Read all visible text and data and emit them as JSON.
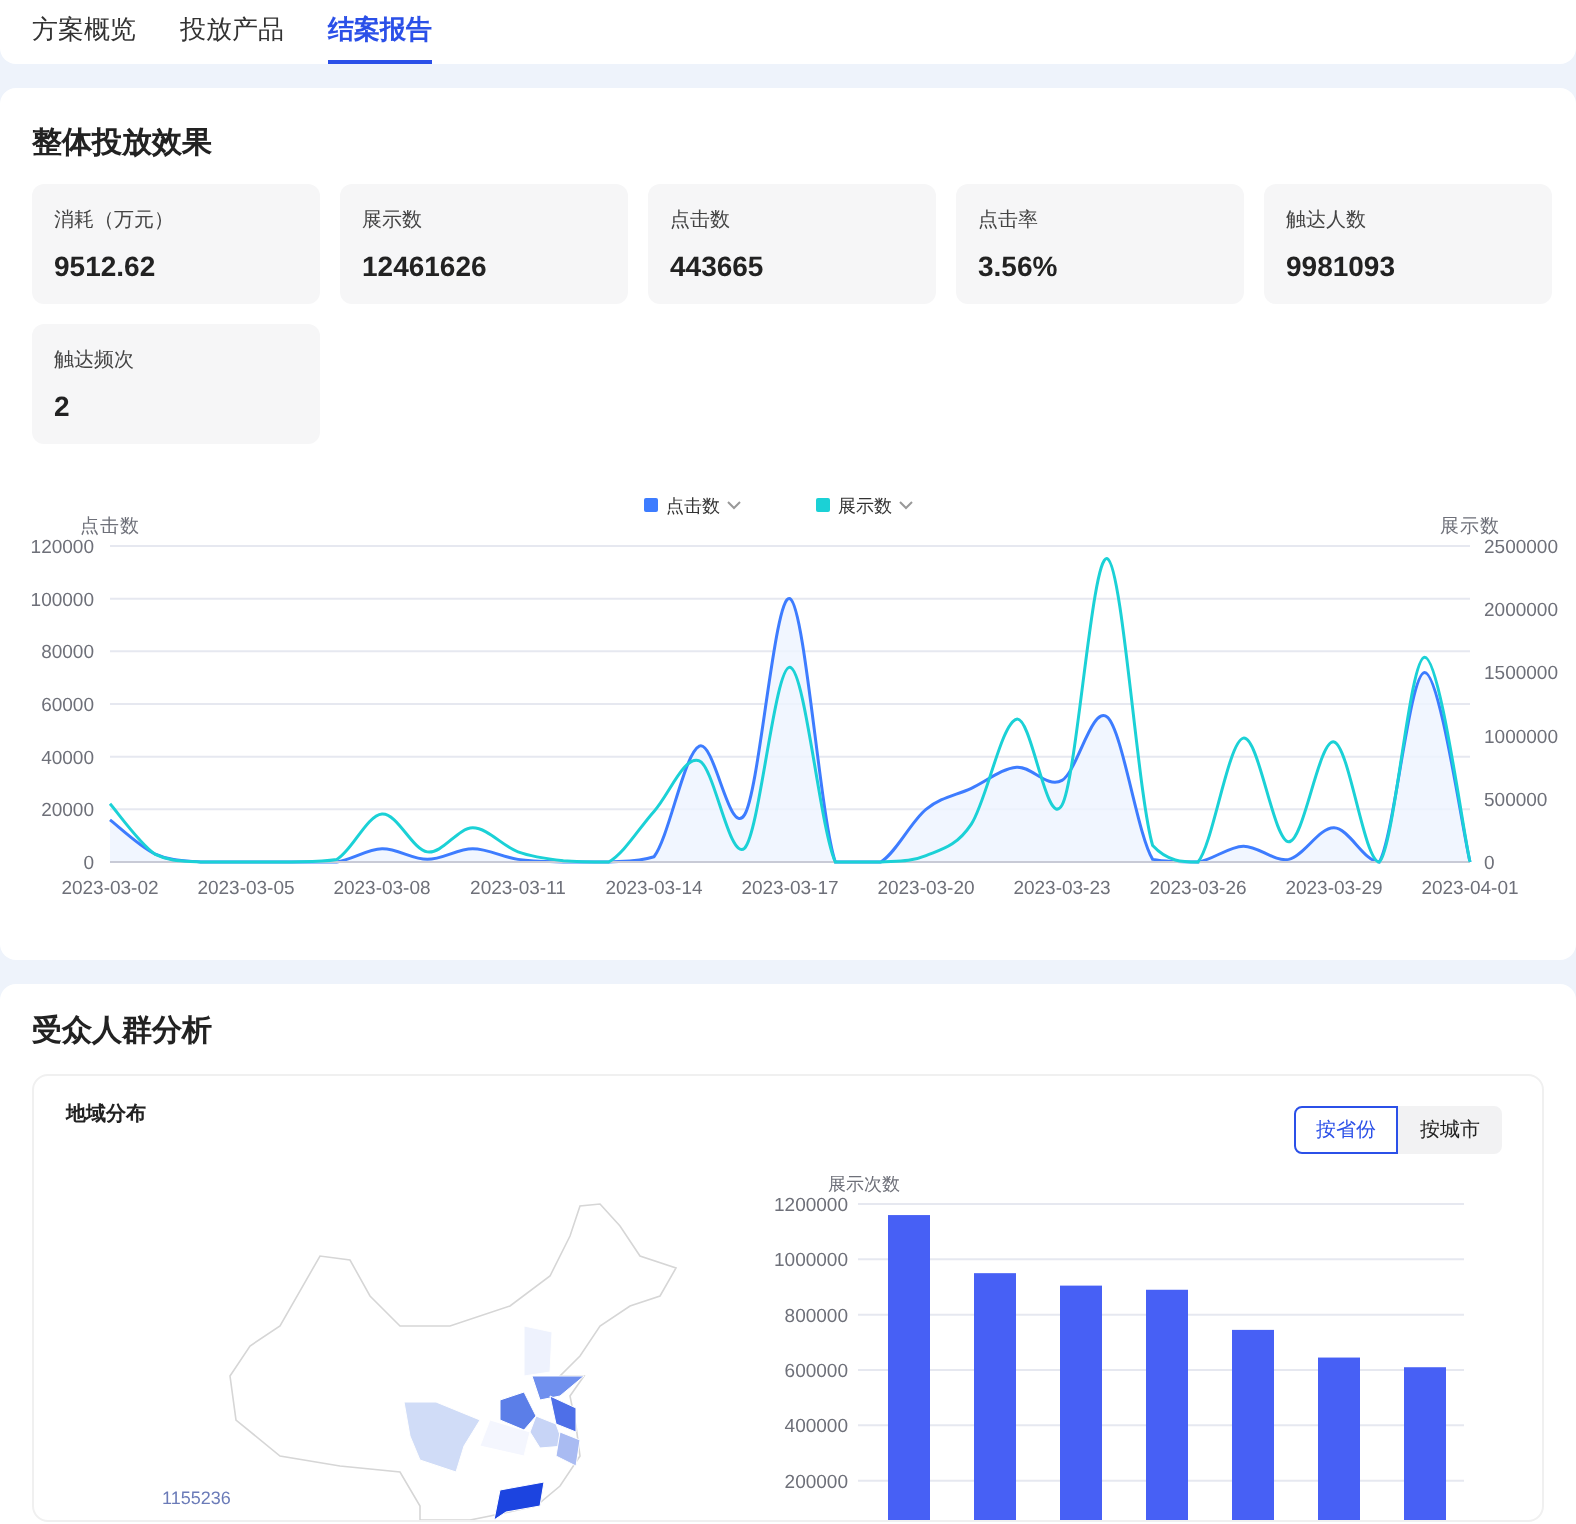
{
  "tabs": [
    {
      "label": "方案概览",
      "selected": false
    },
    {
      "label": "投放产品",
      "selected": false
    },
    {
      "label": "结案报告",
      "selected": true
    }
  ],
  "overview": {
    "title": "整体投放效果",
    "metrics": [
      {
        "label": "消耗（万元）",
        "value": "9512.62"
      },
      {
        "label": "展示数",
        "value": "12461626"
      },
      {
        "label": "点击数",
        "value": "443665"
      },
      {
        "label": "点击率",
        "value": "3.56%"
      },
      {
        "label": "触达人数",
        "value": "9981093"
      },
      {
        "label": "触达频次",
        "value": "2"
      }
    ],
    "click_chart": {
      "chart_data": {
        "type": "line",
        "ylabel": "点击数",
        "grid": true,
        "categories": [
          "2023-03-02",
          null,
          null,
          "2023-03-05",
          null,
          null,
          "2023-03-08",
          null,
          null,
          "2023-03-11",
          null,
          null,
          "2023-03-14",
          null,
          null,
          "2023-03-17",
          null,
          null,
          "2023-03-20",
          null,
          null,
          "2023-03-23",
          null,
          null,
          "2023-03-26",
          null,
          null,
          "2023-03-29",
          null,
          null,
          "2023-04-01"
        ],
        "ylim": [
          0,
          120000
        ],
        "yticks": [
          0,
          20000,
          40000,
          60000,
          80000,
          100000,
          120000
        ],
        "series": [
          {
            "name": "点击数",
            "color": "#3d7cff",
            "values": [
              16000,
              3000,
              0,
              0,
              0,
              0,
              5000,
              1000,
              5000,
              1000,
              0,
              0,
              2000,
              44000,
              18000,
              100000,
              0,
              0,
              20000,
              28000,
              36000,
              31000,
              55000,
              1000,
              0,
              6000,
              1000,
              13000,
              0,
              72000,
              0
            ]
          }
        ]
      }
    },
    "impression_chart": {
      "chart_data": {
        "type": "line",
        "ylabel": "展示数",
        "ylim": [
          0,
          2500000
        ],
        "yticks": [
          0,
          500000,
          1000000,
          1500000,
          2000000,
          2500000
        ],
        "series": [
          {
            "name": "展示数",
            "color": "#1bd1d6",
            "values": [
              460000,
              60000,
              0,
              0,
              0,
              20000,
              380000,
              80000,
              270000,
              80000,
              10000,
              0,
              400000,
              800000,
              110000,
              1540000,
              0,
              0,
              50000,
              300000,
              1130000,
              450000,
              2400000,
              130000,
              0,
              980000,
              160000,
              950000,
              0,
              1620000,
              0
            ]
          }
        ]
      }
    }
  },
  "audience": {
    "title": "受众人群分析",
    "region": {
      "title": "地域分布",
      "toggles": [
        {
          "label": "按省份",
          "selected": true
        },
        {
          "label": "按城市",
          "selected": false
        }
      ],
      "map_legend_max": "1155236",
      "chart_data": {
        "type": "bar",
        "ylabel": "展示次数",
        "grid": true,
        "yticks": [
          200000,
          400000,
          600000,
          800000,
          1000000,
          1200000
        ],
        "ylim": [
          0,
          1200000
        ],
        "values": [
          1160000,
          950000,
          905000,
          890000,
          745000,
          645000,
          610000
        ]
      }
    }
  }
}
